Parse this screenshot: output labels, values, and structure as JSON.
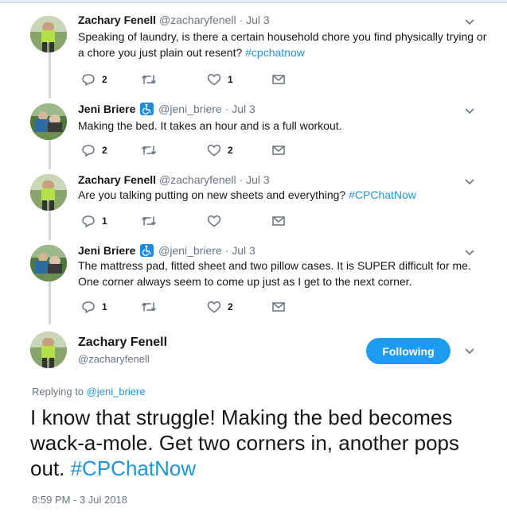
{
  "tweets": [
    {
      "name": "Zachary Fenell",
      "handle": "@zacharyfenell",
      "sep": "·",
      "time": "Jul 3",
      "text_before": "Speaking of laundry, is there a certain household chore you find physically trying or a chore you just plain out resent? ",
      "hashtag": "#cpchatnow",
      "replies": "2",
      "retweets": "",
      "likes": "1"
    },
    {
      "name": "Jeni Briere",
      "handle": "@jeni_briere",
      "sep": "·",
      "time": "Jul 3",
      "text_before": "Making the bed. It takes an hour and is a full workout.",
      "hashtag": "",
      "replies": "2",
      "retweets": "",
      "likes": "2"
    },
    {
      "name": "Zachary Fenell",
      "handle": "@zacharyfenell",
      "sep": "·",
      "time": "Jul 3",
      "text_before": "Are you talking putting on new sheets and everything? ",
      "hashtag": "#CPChatNow",
      "replies": "1",
      "retweets": "",
      "likes": ""
    },
    {
      "name": "Jeni Briere",
      "handle": "@jeni_briere",
      "sep": "·",
      "time": "Jul 3",
      "text_before": "The mattress pad, fitted sheet and two pillow cases. It is SUPER difficult for me. One corner always seem to come up just as I get to the next corner.",
      "hashtag": "",
      "replies": "1",
      "retweets": "",
      "likes": "2"
    }
  ],
  "main": {
    "name": "Zachary Fenell",
    "handle": "@zacharyfenell",
    "follow_label": "Following",
    "replying_prefix": "Replying to ",
    "replying_handle": "@jeni_briere",
    "text_before": "I know that struggle! Making the bed becomes wack-a-mole. Get two corners in, another pops out. ",
    "hashtag": "#CPChatNow",
    "timestamp": "8:59 PM - 3 Jul 2018"
  },
  "icons": {
    "reply": "reply-icon",
    "retweet": "retweet-icon",
    "like": "heart-icon",
    "dm": "mail-icon",
    "more": "chevron-down-icon",
    "badge": "wheelchair-icon"
  },
  "colors": {
    "link": "#1b95e0",
    "button": "#1d9bf0",
    "muted": "#657786",
    "thread_line": "#cfd9e0"
  }
}
